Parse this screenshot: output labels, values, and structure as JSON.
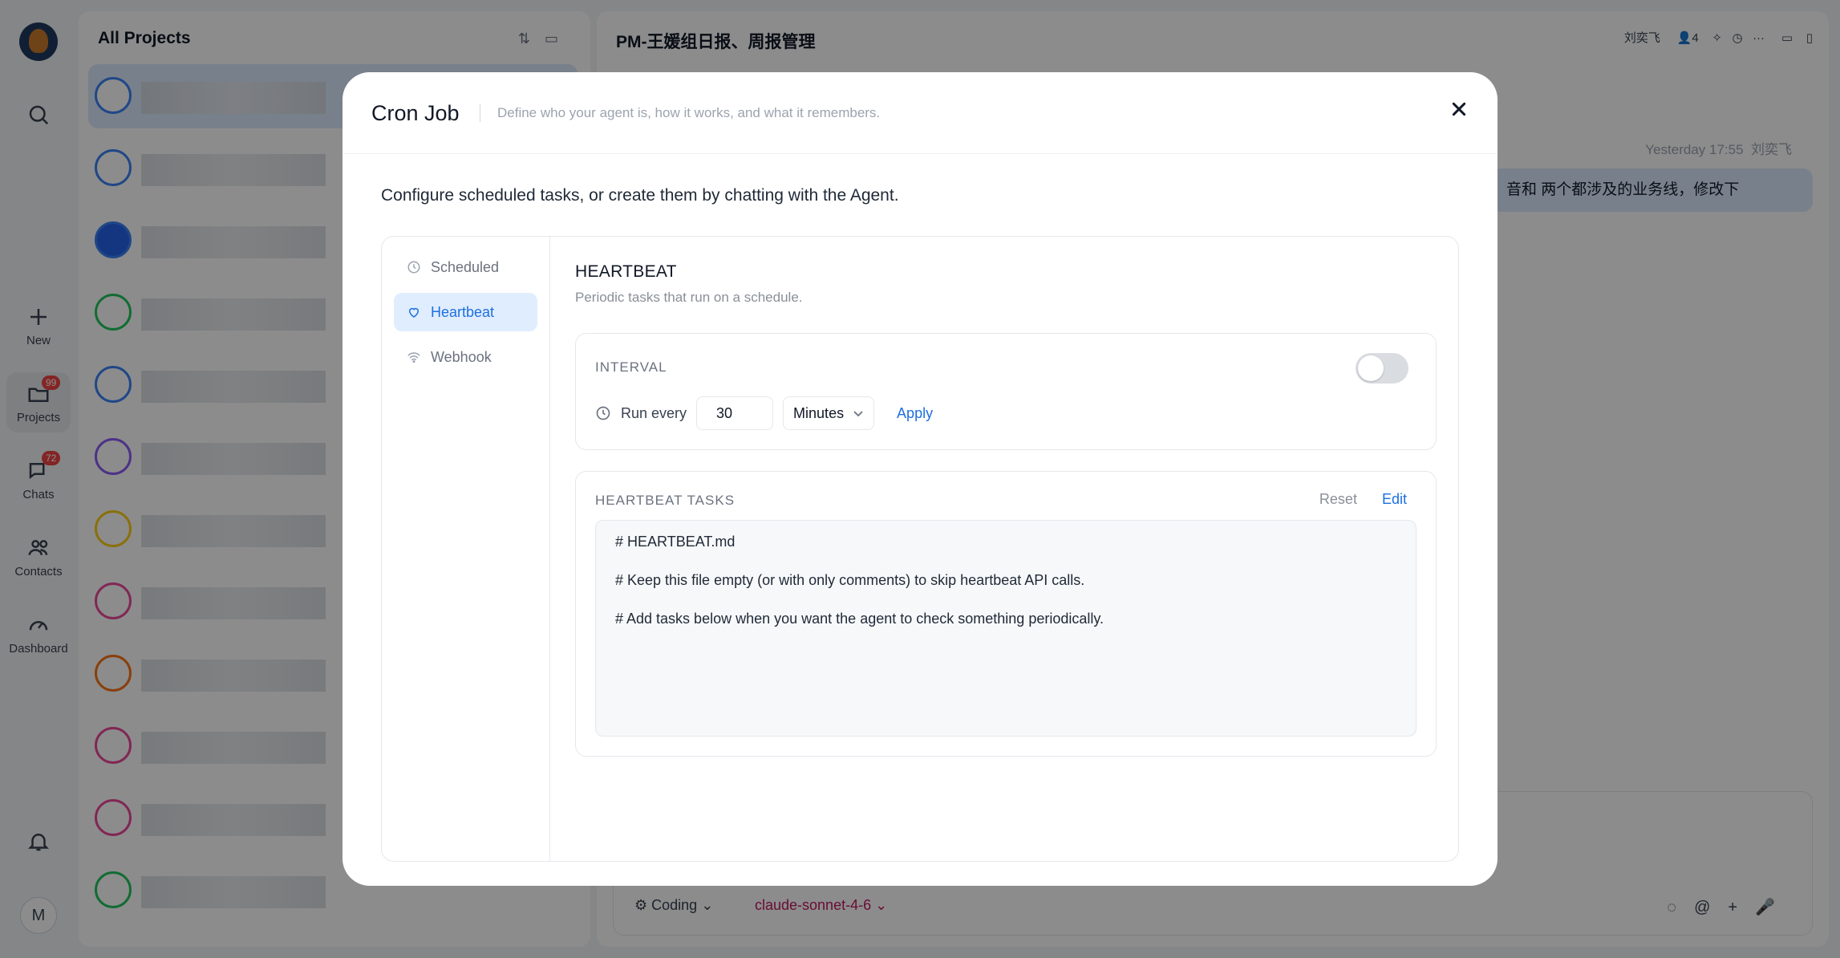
{
  "app": {
    "rail": {
      "new_label": "New",
      "projects_label": "Projects",
      "projects_badge": "99",
      "chats_label": "Chats",
      "chats_badge": "72",
      "contacts_label": "Contacts",
      "dashboard_label": "Dashboard",
      "user_initial": "M"
    },
    "list": {
      "title": "All Projects"
    },
    "chat": {
      "title": "PM-王媛组日报、周报管理",
      "owner_chip": "刘奕飞",
      "member_count": "4",
      "timestamp": "Yesterday 17:55",
      "sender": "刘奕飞",
      "message_snippet": "音和 两个都涉及的业务线，修改下",
      "mode_label": "Coding",
      "model_label": "claude-sonnet-4-6"
    }
  },
  "modal": {
    "title": "Cron Job",
    "subtitle": "Define who your agent is, how it works, and what it remembers.",
    "intro": "Configure scheduled tasks, or create them by chatting with the Agent.",
    "nav": [
      {
        "label": "Scheduled",
        "icon": "clock-icon"
      },
      {
        "label": "Heartbeat",
        "icon": "heart-icon",
        "active": true
      },
      {
        "label": "Webhook",
        "icon": "wifi-icon"
      }
    ],
    "section": {
      "title": "HEARTBEAT",
      "subtitle": "Periodic tasks that run on a schedule."
    },
    "interval": {
      "label": "INTERVAL",
      "enabled": false,
      "run_every_label": "Run every",
      "value": "30",
      "unit": "Minutes",
      "apply_label": "Apply"
    },
    "tasks": {
      "label": "HEARTBEAT TASKS",
      "reset_label": "Reset",
      "edit_label": "Edit",
      "lines": [
        "# HEARTBEAT.md",
        "# Keep this file empty (or with only comments) to skip heartbeat API calls.",
        "# Add tasks below when you want the agent to check something periodically."
      ]
    }
  },
  "colors": {
    "accent": "#1d6fe0",
    "active_nav_bg": "#e0edff",
    "overlay": "rgba(0,0,0,0.45)"
  }
}
